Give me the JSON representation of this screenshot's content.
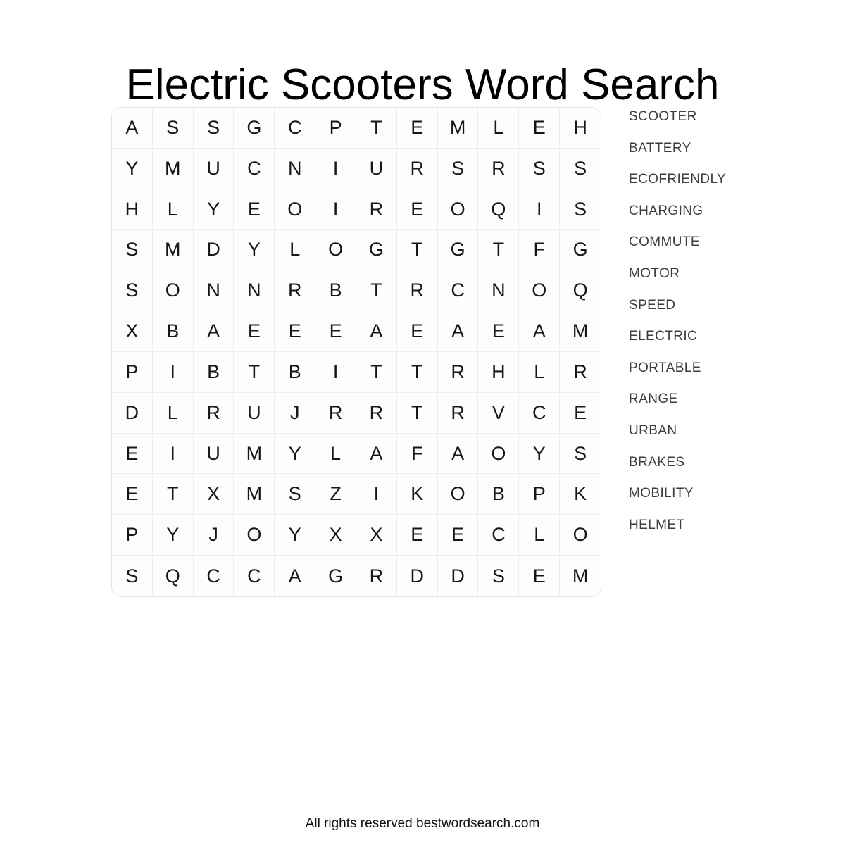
{
  "page": {
    "title": "Electric Scooters Word Search",
    "footer": "All rights reserved bestwordsearch.com"
  },
  "puzzle": {
    "rows": 12,
    "cols": 12,
    "grid": [
      [
        "A",
        "S",
        "S",
        "G",
        "C",
        "P",
        "T",
        "E",
        "M",
        "L",
        "E",
        "H"
      ],
      [
        "Y",
        "M",
        "U",
        "C",
        "N",
        "I",
        "U",
        "R",
        "S",
        "R",
        "S",
        "S"
      ],
      [
        "H",
        "L",
        "Y",
        "E",
        "O",
        "I",
        "R",
        "E",
        "O",
        "Q",
        "I",
        "S"
      ],
      [
        "S",
        "M",
        "D",
        "Y",
        "L",
        "O",
        "G",
        "T",
        "G",
        "T",
        "F",
        "G"
      ],
      [
        "S",
        "O",
        "N",
        "N",
        "R",
        "B",
        "T",
        "R",
        "C",
        "N",
        "O",
        "Q"
      ],
      [
        "X",
        "B",
        "A",
        "E",
        "E",
        "E",
        "A",
        "E",
        "A",
        "E",
        "A",
        "M"
      ],
      [
        "P",
        "I",
        "B",
        "T",
        "B",
        "I",
        "T",
        "T",
        "R",
        "H",
        "L",
        "R"
      ],
      [
        "D",
        "L",
        "R",
        "U",
        "J",
        "R",
        "R",
        "T",
        "R",
        "V",
        "C",
        "E"
      ],
      [
        "E",
        "I",
        "U",
        "M",
        "Y",
        "L",
        "A",
        "F",
        "A",
        "O",
        "Y",
        "S"
      ],
      [
        "E",
        "T",
        "X",
        "M",
        "S",
        "Z",
        "I",
        "K",
        "O",
        "B",
        "P",
        "K"
      ],
      [
        "P",
        "Y",
        "J",
        "O",
        "Y",
        "X",
        "X",
        "E",
        "E",
        "C",
        "L",
        "O"
      ],
      [
        "S",
        "Q",
        "C",
        "C",
        "A",
        "G",
        "R",
        "D",
        "D",
        "S",
        "E",
        "M"
      ]
    ],
    "words": [
      "SCOOTER",
      "BATTERY",
      "ECOFRIENDLY",
      "CHARGING",
      "COMMUTE",
      "MOTOR",
      "SPEED",
      "ELECTRIC",
      "PORTABLE",
      "RANGE",
      "URBAN",
      "BRAKES",
      "MOBILITY",
      "HELMET"
    ]
  },
  "colors": {
    "title_text": "#000000",
    "grid_letter": "#17171a",
    "grid_line": "#ececf2",
    "grid_border": "#e4e4ee",
    "grid_background": "#fdfdfe",
    "word_text": "#3d3d42",
    "footer_text": "#111111",
    "page_background": "#ffffff"
  }
}
